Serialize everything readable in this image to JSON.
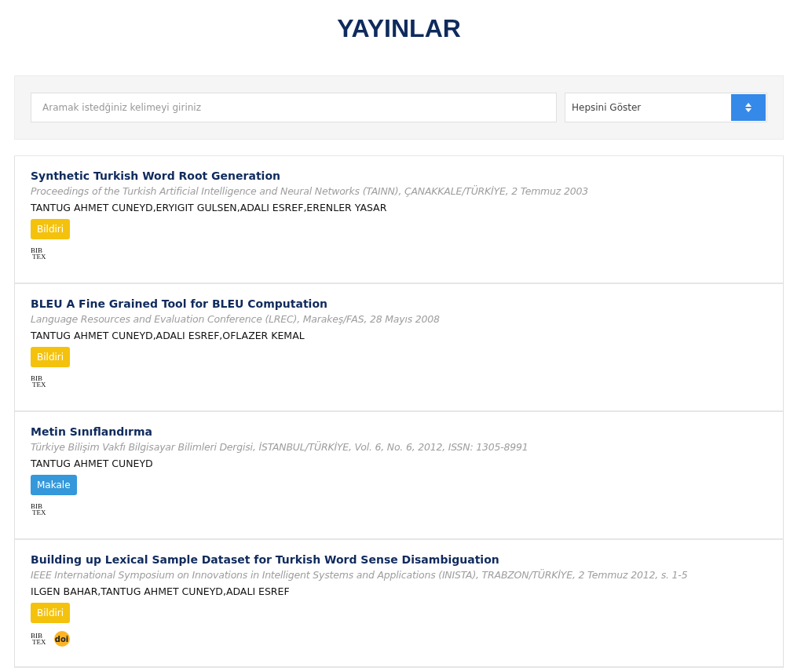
{
  "page_title": "YAYINLAR",
  "filter": {
    "search_placeholder": "Aramak istedğiniz kelimeyi giriniz",
    "select_value": "Hepsini Göster"
  },
  "publications": [
    {
      "title": "Synthetic Turkish Word Root Generation",
      "venue": "Proceedings of the Turkish Artificial Intelligence and Neural Networks (TAINN), ÇANAKKALE/TÜRKİYE, 2 Temmuz 2003",
      "authors": "TANTUG AHMET CUNEYD,ERYIGIT GULSEN,ADALI ESREF,ERENLER YASAR",
      "type": {
        "kind": "bildiri",
        "label": "Bildiri"
      },
      "links": [
        {
          "kind": "bibtex",
          "top": "BIB",
          "bottom": "TEX"
        }
      ]
    },
    {
      "title": "BLEU A Fine Grained Tool for BLEU Computation",
      "venue": "Language Resources and Evaluation Conference (LREC), Marakeş/FAS, 28 Mayıs 2008",
      "authors": "TANTUG AHMET CUNEYD,ADALI ESREF,OFLAZER KEMAL",
      "type": {
        "kind": "bildiri",
        "label": "Bildiri"
      },
      "links": [
        {
          "kind": "bibtex",
          "top": "BIB",
          "bottom": "TEX"
        }
      ]
    },
    {
      "title": "Metin Sınıflandırma",
      "venue": "Türkiye Bilişim Vakfı Bilgisayar Bilimleri Dergisi, İSTANBUL/TÜRKİYE, Vol. 6, No. 6, 2012, ISSN: 1305-8991",
      "authors": "TANTUG AHMET CUNEYD",
      "type": {
        "kind": "makale",
        "label": "Makale"
      },
      "links": [
        {
          "kind": "bibtex",
          "top": "BIB",
          "bottom": "TEX"
        }
      ]
    },
    {
      "title": "Building up Lexical Sample Dataset for Turkish Word Sense Disambiguation",
      "venue": "IEEE International Symposium on Innovations in Intelligent Systems and Applications (INISTA), TRABZON/TÜRKİYE, 2 Temmuz 2012, s. 1-5",
      "authors": "ILGEN BAHAR,TANTUG AHMET CUNEYD,ADALI ESREF",
      "type": {
        "kind": "bildiri",
        "label": "Bildiri"
      },
      "links": [
        {
          "kind": "bibtex",
          "top": "BIB",
          "bottom": "TEX"
        },
        {
          "kind": "doi",
          "label": "doi"
        }
      ]
    }
  ]
}
